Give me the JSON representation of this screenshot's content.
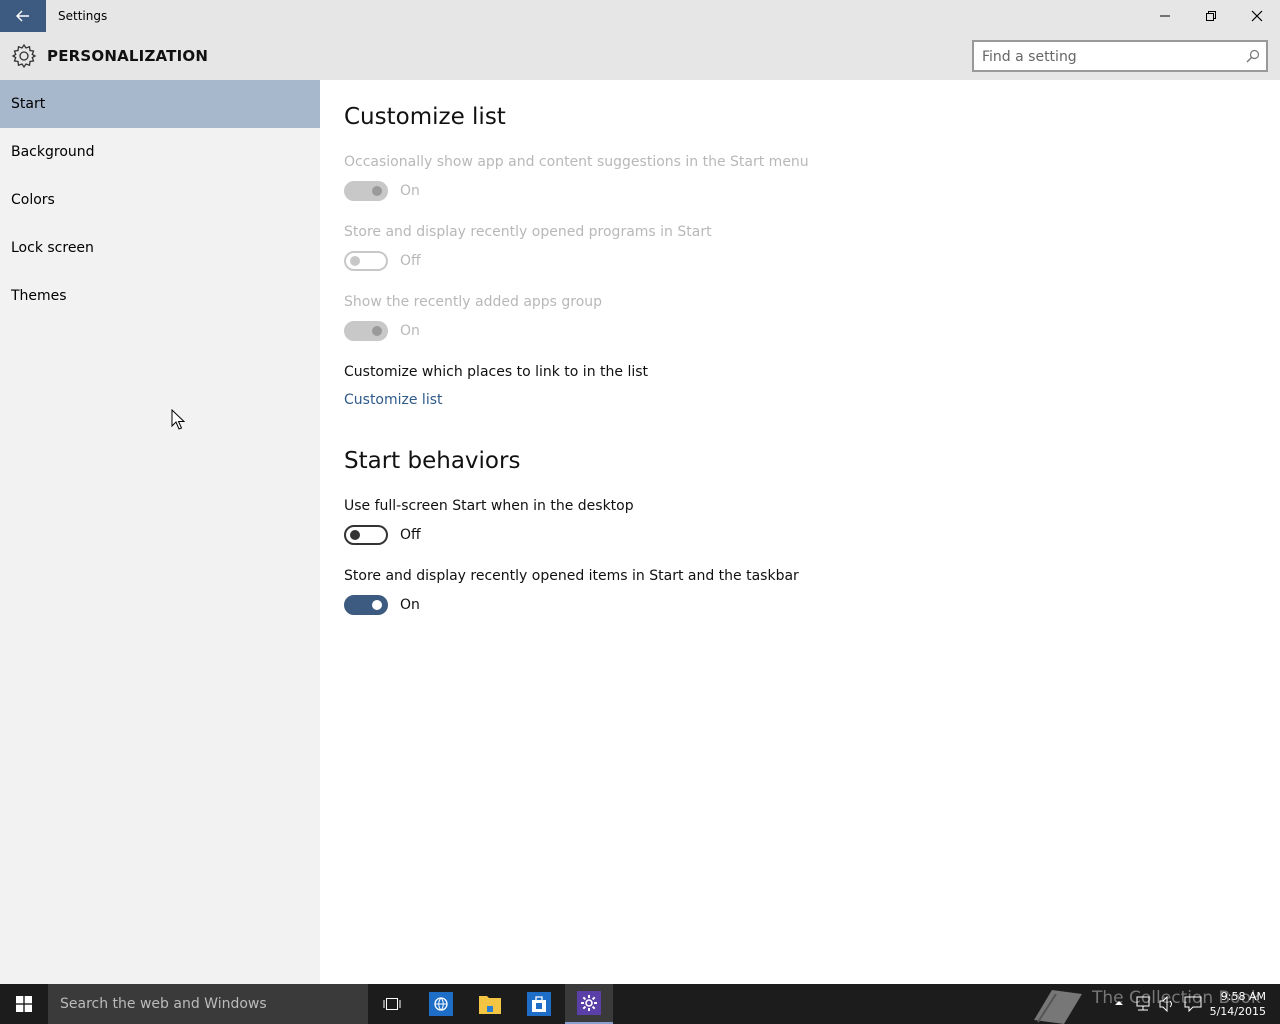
{
  "window": {
    "title": "Settings"
  },
  "header": {
    "title": "PERSONALIZATION",
    "search_placeholder": "Find a setting"
  },
  "sidebar": {
    "items": [
      {
        "label": "Start",
        "active": true
      },
      {
        "label": "Background",
        "active": false
      },
      {
        "label": "Colors",
        "active": false
      },
      {
        "label": "Lock screen",
        "active": false
      },
      {
        "label": "Themes",
        "active": false
      }
    ]
  },
  "content": {
    "customize_list": {
      "title": "Customize list",
      "settings": [
        {
          "label": "Occasionally show app and content suggestions in the Start menu",
          "state": "On",
          "enabled": false
        },
        {
          "label": "Store and display recently opened programs in Start",
          "state": "Off",
          "enabled": false
        },
        {
          "label": "Show the recently added apps group",
          "state": "On",
          "enabled": false
        }
      ],
      "places_label": "Customize which places to link to in the list",
      "places_link": "Customize list"
    },
    "start_behaviors": {
      "title": "Start behaviors",
      "settings": [
        {
          "label": "Use full-screen Start when in the desktop",
          "state": "Off",
          "enabled": true
        },
        {
          "label": "Store and display recently opened items in Start and the taskbar",
          "state": "On",
          "enabled": true
        }
      ]
    }
  },
  "taskbar": {
    "search_placeholder": "Search the web and Windows",
    "watermark": "The Collection Book",
    "time": "9:58 AM",
    "date": "5/14/2015"
  },
  "colors": {
    "accent": "#3d5a80",
    "active_nav": "#a8b8cc",
    "link": "#2e5a8a"
  }
}
